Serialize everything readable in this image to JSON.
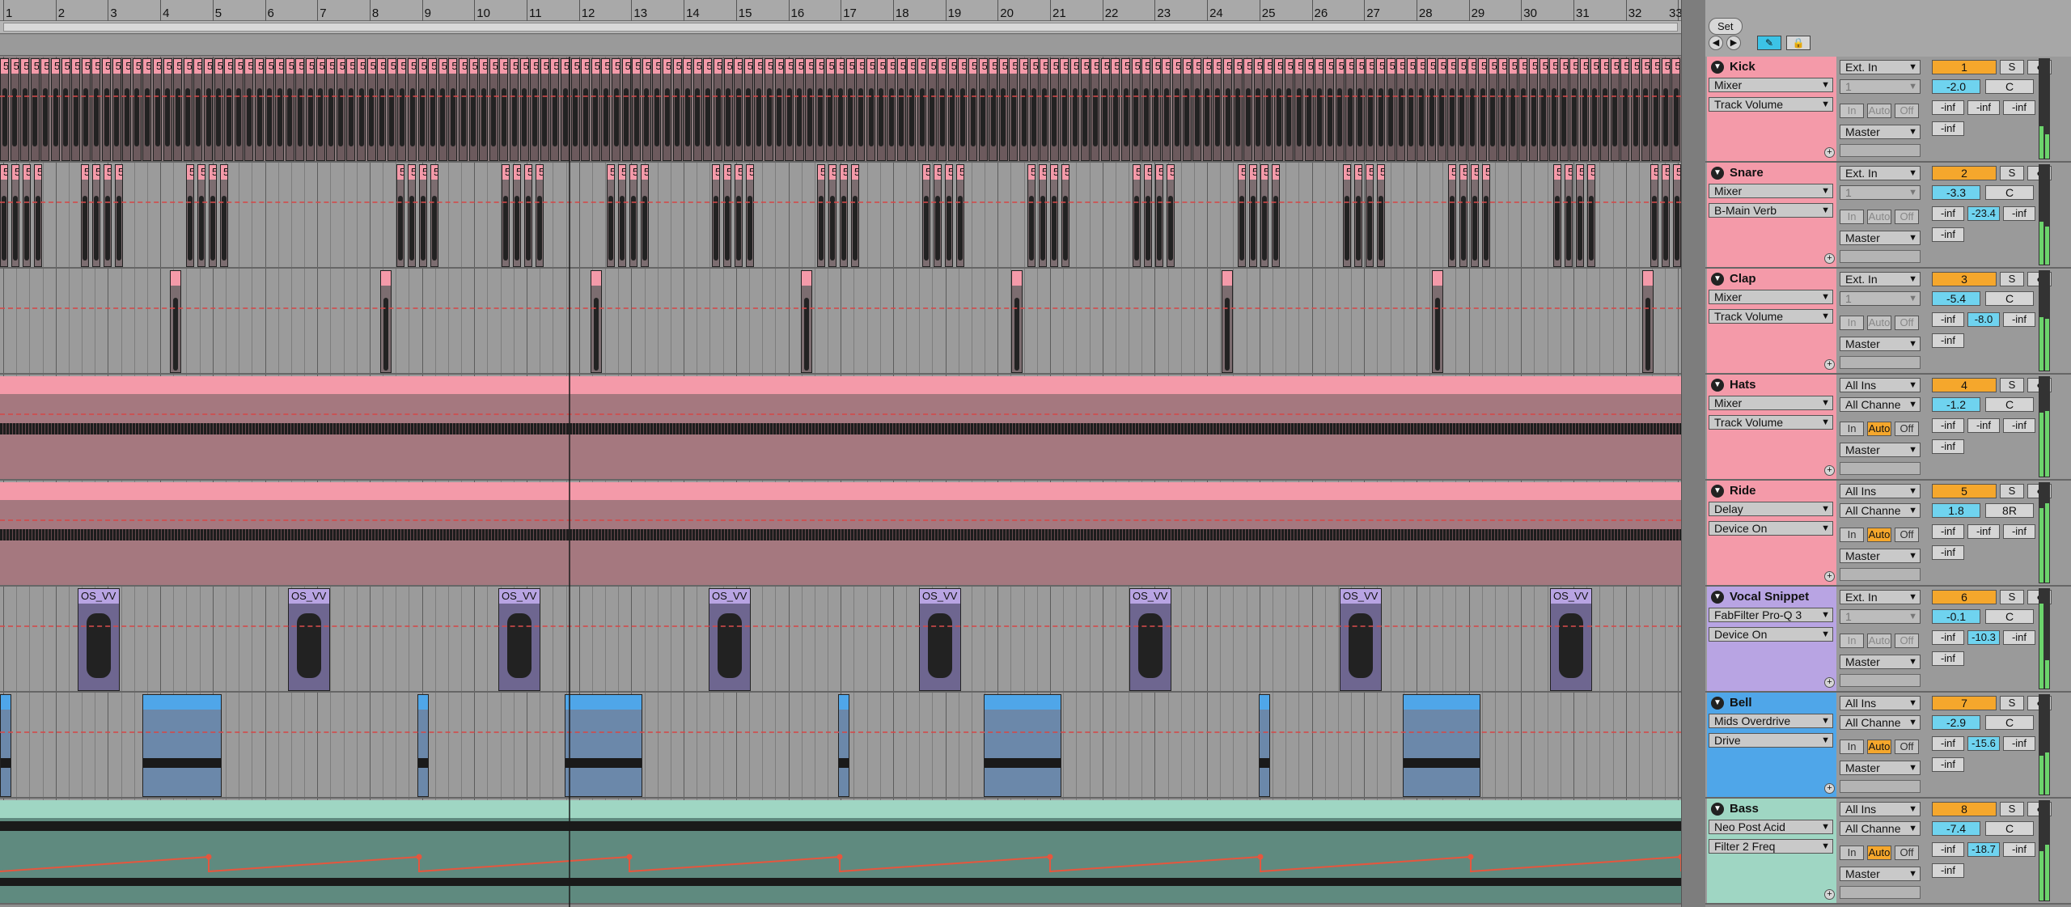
{
  "ruler": {
    "bars": [
      "1",
      "2",
      "3",
      "4",
      "5",
      "6",
      "7",
      "8",
      "9",
      "10",
      "11",
      "12",
      "13",
      "14",
      "15",
      "16",
      "17",
      "18",
      "19",
      "20",
      "21",
      "22",
      "23",
      "24",
      "25",
      "26",
      "27",
      "28",
      "29",
      "30",
      "31",
      "32",
      "33"
    ]
  },
  "header": {
    "set_label": "Set",
    "nav_back_icon": "circle-arrow-left-icon",
    "nav_forward_icon": "circle-arrow-right-icon",
    "draw_mode_icon": "pencil-icon",
    "lock_icon": "lock-icon"
  },
  "colors": {
    "kick": "#f49aa9",
    "snare": "#f49aa9",
    "clap": "#f49aa9",
    "hats": "#f49aa9",
    "ride": "#f49aa9",
    "vocal": "#b8a4e3",
    "bell": "#4fa6e9",
    "bass": "#9fd6c3",
    "monitor_on": "#f5a72c",
    "volume": "#6fd3ef",
    "draw_mode": "#3cc3e6"
  },
  "tracks": [
    {
      "name": "Kick",
      "color": "#f49aa9",
      "device": "Mixer",
      "param": "Track Volume",
      "input": "Ext. In",
      "channel": "1",
      "channel_dim": true,
      "monitor": [
        "In",
        "Auto",
        "Off"
      ],
      "monitor_active": "",
      "monitor_dim": true,
      "output": "Master",
      "number": "1",
      "solo": "S",
      "arm_icon": "record-arm-icon",
      "volume": "-2.0",
      "pan": "C",
      "sends": [
        "-inf",
        "-inf",
        "-inf"
      ],
      "extra": "-inf",
      "clip_label": "5"
    },
    {
      "name": "Snare",
      "color": "#f49aa9",
      "device": "Mixer",
      "param": "B-Main Verb",
      "input": "Ext. In",
      "channel": "1",
      "channel_dim": true,
      "monitor": [
        "In",
        "Auto",
        "Off"
      ],
      "monitor_active": "",
      "monitor_dim": true,
      "output": "Master",
      "number": "2",
      "solo": "S",
      "arm_icon": "record-arm-icon",
      "volume": "-3.3",
      "pan": "C",
      "sends": [
        "-inf",
        "-23.4",
        "-inf"
      ],
      "extra": "-inf",
      "clip_label": "5"
    },
    {
      "name": "Clap",
      "color": "#f49aa9",
      "device": "Mixer",
      "param": "Track Volume",
      "input": "Ext. In",
      "channel": "1",
      "channel_dim": true,
      "monitor": [
        "In",
        "Auto",
        "Off"
      ],
      "monitor_active": "",
      "monitor_dim": true,
      "output": "Master",
      "number": "3",
      "solo": "S",
      "arm_icon": "record-arm-icon",
      "volume": "-5.4",
      "pan": "C",
      "sends": [
        "-inf",
        "-8.0",
        "-inf"
      ],
      "extra": "-inf",
      "clip_label": ""
    },
    {
      "name": "Hats",
      "color": "#f49aa9",
      "device": "Mixer",
      "param": "Track Volume",
      "input": "All Ins",
      "channel": "All Channe",
      "channel_dim": false,
      "monitor": [
        "In",
        "Auto",
        "Off"
      ],
      "monitor_active": "Auto",
      "monitor_dim": false,
      "output": "Master",
      "number": "4",
      "solo": "S",
      "arm_icon": "midi-arm-icon",
      "volume": "-1.2",
      "pan": "C",
      "sends": [
        "-inf",
        "-inf",
        "-inf"
      ],
      "extra": "-inf",
      "clip_label": ""
    },
    {
      "name": "Ride",
      "color": "#f49aa9",
      "device": "Delay",
      "param": "Device On",
      "input": "All Ins",
      "channel": "All Channe",
      "channel_dim": false,
      "monitor": [
        "In",
        "Auto",
        "Off"
      ],
      "monitor_active": "Auto",
      "monitor_dim": false,
      "output": "Master",
      "number": "5",
      "solo": "S",
      "arm_icon": "midi-arm-icon",
      "volume": "1.8",
      "pan": "8R",
      "sends": [
        "-inf",
        "-inf",
        "-inf"
      ],
      "extra": "-inf",
      "clip_label": ""
    },
    {
      "name": "Vocal Snippet",
      "color": "#b8a4e3",
      "device": "FabFilter Pro-Q 3",
      "param": "Device On",
      "input": "Ext. In",
      "channel": "1",
      "channel_dim": true,
      "monitor": [
        "In",
        "Auto",
        "Off"
      ],
      "monitor_active": "",
      "monitor_dim": true,
      "output": "Master",
      "number": "6",
      "solo": "S",
      "arm_icon": "record-arm-icon",
      "volume": "-0.1",
      "pan": "C",
      "sends": [
        "-inf",
        "-10.3",
        "-inf"
      ],
      "extra": "-inf",
      "clip_label": "OS_VV"
    },
    {
      "name": "Bell",
      "color": "#4fa6e9",
      "device": "Mids Overdrive",
      "param": "Drive",
      "input": "All Ins",
      "channel": "All Channe",
      "channel_dim": false,
      "monitor": [
        "In",
        "Auto",
        "Off"
      ],
      "monitor_active": "Auto",
      "monitor_dim": false,
      "output": "Master",
      "number": "7",
      "solo": "S",
      "arm_icon": "midi-arm-icon",
      "volume": "-2.9",
      "pan": "C",
      "sends": [
        "-inf",
        "-15.6",
        "-inf"
      ],
      "extra": "-inf",
      "clip_label": ""
    },
    {
      "name": "Bass",
      "color": "#9fd6c3",
      "device": "Neo Post Acid",
      "param": "Filter 2 Freq",
      "input": "All Ins",
      "channel": "All Channe",
      "channel_dim": false,
      "monitor": [
        "In",
        "Auto",
        "Off"
      ],
      "monitor_active": "Auto",
      "monitor_dim": false,
      "output": "Master",
      "number": "8",
      "solo": "S",
      "arm_icon": "midi-arm-icon",
      "volume": "-7.4",
      "pan": "C",
      "sends": [
        "-inf",
        "-18.7",
        "-inf"
      ],
      "extra": "-inf",
      "clip_label": ""
    }
  ]
}
